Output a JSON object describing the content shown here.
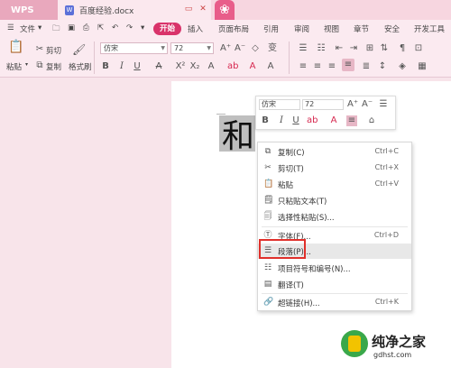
{
  "app": {
    "logo": "WPS",
    "doc_tab_icon": "W",
    "doc_title": "百度经验.docx"
  },
  "menu": {
    "file": "文件",
    "start": "开始",
    "items": [
      "插入",
      "页面布局",
      "引用",
      "审阅",
      "视图",
      "章节",
      "安全",
      "开发工具"
    ]
  },
  "ribbon": {
    "cut": "剪切",
    "paste": "粘贴",
    "copy": "复制",
    "format_painter": "格式刷",
    "font_name": "仿宋",
    "font_size": "72"
  },
  "document": {
    "selected_glyph": "和"
  },
  "mini_toolbar": {
    "font_name": "仿宋",
    "font_size": "72"
  },
  "context_menu": {
    "items": [
      {
        "label": "复制(C)",
        "shortcut": "Ctrl+C",
        "icon": "copy-icon"
      },
      {
        "label": "剪切(T)",
        "shortcut": "Ctrl+X",
        "icon": "scissors-icon"
      },
      {
        "label": "粘贴",
        "shortcut": "Ctrl+V",
        "icon": "paste-icon"
      },
      {
        "label": "只粘贴文本(T)",
        "shortcut": "",
        "icon": "paste-text-icon"
      },
      {
        "label": "选择性粘贴(S)...",
        "shortcut": "",
        "icon": "paste-special-icon"
      },
      {
        "label": "字体(F)...",
        "shortcut": "Ctrl+D",
        "icon": "font-icon"
      },
      {
        "label": "段落(P)...",
        "shortcut": "",
        "icon": "paragraph-icon"
      },
      {
        "label": "项目符号和编号(N)...",
        "shortcut": "",
        "icon": "bullets-icon"
      },
      {
        "label": "翻译(T)",
        "shortcut": "",
        "icon": "translate-icon"
      },
      {
        "label": "超链接(H)...",
        "shortcut": "Ctrl+K",
        "icon": "link-icon"
      }
    ]
  },
  "watermark": {
    "text": "纯净之家",
    "url": "gdhst.com"
  },
  "colors": {
    "accent": "#d9336a",
    "highlight_box": "#e0302b"
  }
}
